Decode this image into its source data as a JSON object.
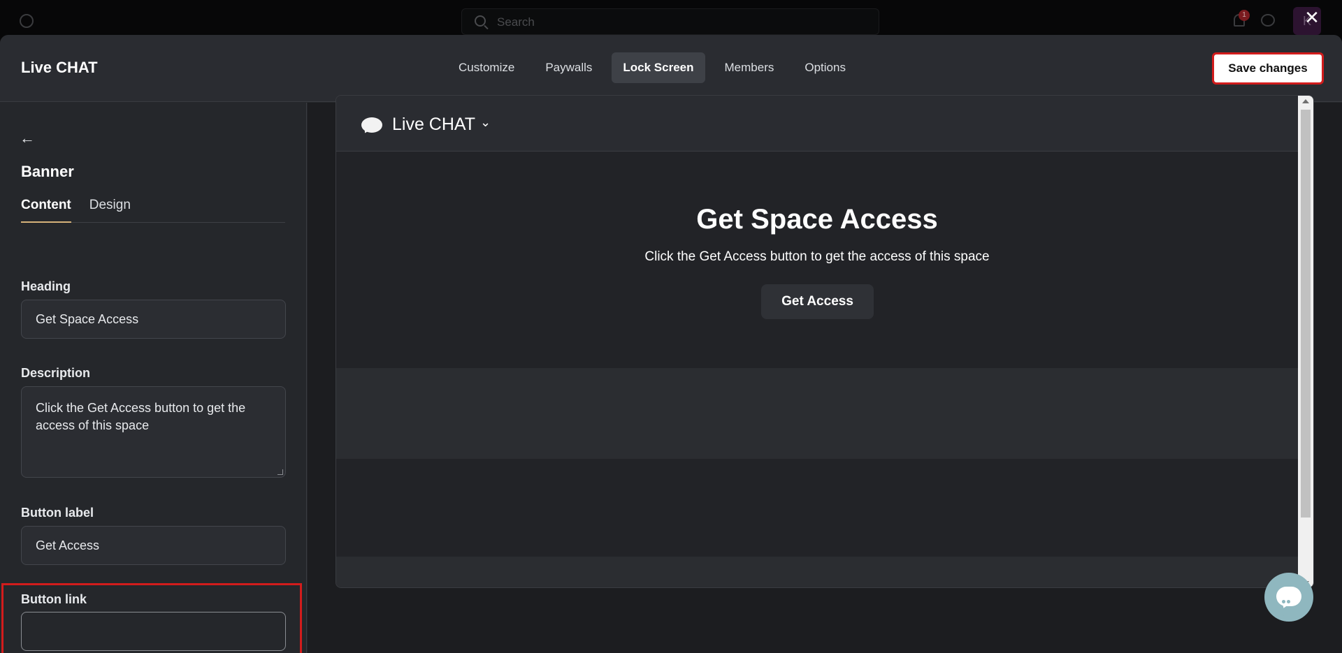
{
  "background_app": {
    "search_placeholder": "Search",
    "notification_count": "1",
    "avatar_initial": "K"
  },
  "modal": {
    "title": "Live CHAT",
    "tabs": [
      {
        "label": "Customize"
      },
      {
        "label": "Paywalls"
      },
      {
        "label": "Lock Screen",
        "active": true
      },
      {
        "label": "Members"
      },
      {
        "label": "Options"
      }
    ],
    "save_label": "Save changes"
  },
  "left_panel": {
    "title": "Banner",
    "subtabs": [
      {
        "label": "Content",
        "active": true
      },
      {
        "label": "Design"
      }
    ],
    "heading_label": "Heading",
    "heading_value": "Get Space Access",
    "description_label": "Description",
    "description_value": "Click the Get Access button to get the access of this space",
    "button_label_label": "Button label",
    "button_label_value": "Get Access",
    "button_link_label": "Button link",
    "button_link_value": ""
  },
  "preview": {
    "space_name": "Live CHAT",
    "heading": "Get Space Access",
    "description": "Click the Get Access button to get the access of this space",
    "button": "Get Access"
  },
  "colors": {
    "highlight": "#d21c1c",
    "accent_underline": "#d6b27a",
    "chat_fab": "#8fb7bf"
  }
}
